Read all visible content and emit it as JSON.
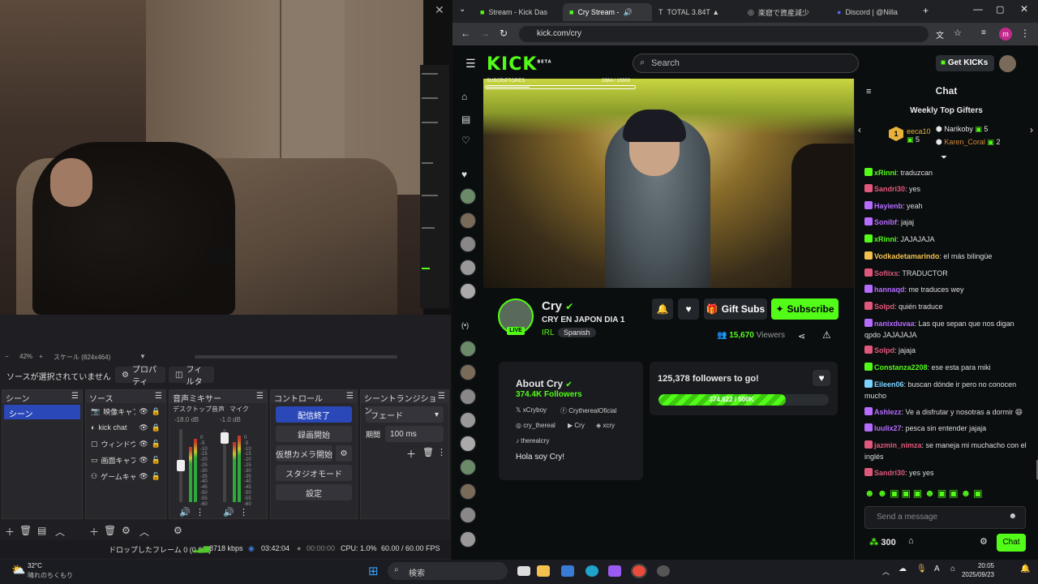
{
  "obs": {
    "zoom": "42%",
    "scale_label": "スケール (824x464)",
    "no_source": "ソースが選択されていません",
    "properties": "プロパティ",
    "filters": "フィルタ",
    "docks": {
      "scenes": "シーン",
      "sources": "ソース",
      "mixer": "音声ミキサー",
      "controls": "コントロール",
      "transitions": "シーントランジション"
    },
    "scene_item": "シーン",
    "sources": [
      "映像キャプ",
      "kick chat",
      "ウィンドウキ",
      "画面キャプ",
      "ゲームキャプ"
    ],
    "mixer": {
      "ch1": "デスクトップ音声",
      "ch1_db": "-18.0 dB",
      "ch2": "マイク",
      "ch2_db": "-1.0 dB",
      "scale": [
        "0",
        "-5",
        "-10",
        "-15",
        "-20",
        "-25",
        "-30",
        "-35",
        "-40",
        "-45",
        "-50",
        "-55",
        "-60"
      ]
    },
    "controls": [
      "配信終了",
      "録画開始",
      "仮想カメラ開始",
      "スタジオモード",
      "設定"
    ],
    "transition": "フェード",
    "duration_label": "期間",
    "duration": "100 ms",
    "status": {
      "dropped": "ドロップしたフレーム 0 (0.0%)",
      "kbps": "8718 kbps",
      "stream_time": "03:42:04",
      "rec_time": "00:00:00",
      "cpu": "CPU: 1.0%",
      "fps": "60.00 / 60.00 FPS"
    }
  },
  "browser": {
    "tabs": [
      "Stream - Kick Das",
      "Cry Stream - ",
      "TOTAL 3.84T ▲",
      "楽窟で資産減少",
      "Discord | @Nilla"
    ],
    "url": "kick.com/cry",
    "profile": "m"
  },
  "kick": {
    "logo": "KICK",
    "beta": "BETA",
    "search": "Search",
    "get_kicks": "Get KICKs",
    "sub_label": "SUSCRIPTORES",
    "sub_count": "2884 / 10000",
    "sub_fraction": 0.2884,
    "channel": "Cry",
    "title": "CRY EN JAPON DIA 1",
    "category": "IRL",
    "language": "Spanish",
    "live": "LIVE",
    "gift": "Gift Subs",
    "subscribe": "Subscribe",
    "viewers": "15,670",
    "viewers_label": "Viewers",
    "about_title": "About Cry",
    "followers": "374.4K",
    "followers_label": "Followers",
    "socials": [
      "xCryboy",
      "CrytherealOficial",
      "cry_thereal",
      "Cry",
      "xcry",
      "therealcry"
    ],
    "bio": "Hola soy Cry!",
    "goal_title": "125,378 followers to go!",
    "goal_progress": "374,622 / 500K",
    "goal_fraction": 0.749
  },
  "chat": {
    "title": "Chat",
    "gifters_title": "Weekly Top Gifters",
    "gifters": [
      {
        "name": "eeca10",
        "count": "5",
        "color": "#e8b13a"
      },
      {
        "name": "Narikoby",
        "count": "5",
        "color": "#cfcfcf"
      },
      {
        "name": "Karen_Coral",
        "count": "2",
        "color": "#d58a3a"
      }
    ],
    "messages": [
      {
        "user": "xRinni",
        "text": "traduzcan",
        "color": "#53fc18"
      },
      {
        "user": "Sandri30",
        "text": "yes",
        "color": "#e0587b"
      },
      {
        "user": "Hayienb",
        "text": "yeah",
        "color": "#b56cff"
      },
      {
        "user": "Sonibf",
        "text": "jajaj",
        "color": "#b56cff"
      },
      {
        "user": "xRinni",
        "text": "JAJAJAJA",
        "color": "#53fc18"
      },
      {
        "user": "Vodkadetamarindo",
        "text": "el más bilingüe",
        "color": "#f2c14e"
      },
      {
        "user": "Sofiixs",
        "text": "TRADUCTOR",
        "color": "#e0587b"
      },
      {
        "user": "hannaqd",
        "text": "me traduces wey",
        "color": "#b56cff"
      },
      {
        "user": "Solpd",
        "text": "quién traduce",
        "color": "#e0587b"
      },
      {
        "user": "nanixduvaa",
        "text": "Las que sepan que nos digan qpdo JAJAJAJA",
        "color": "#b56cff"
      },
      {
        "user": "Solpd",
        "text": "jajaja",
        "color": "#e0587b"
      },
      {
        "user": "Constanza2208",
        "text": "ese esta para miki",
        "color": "#53fc18"
      },
      {
        "user": "Eileen06",
        "text": "buscan dónde ir pero no conocen mucho",
        "color": "#7ad3ff"
      },
      {
        "user": "Ashlezz",
        "text": "Ve a disfrutar y nosotras a dormir 😄",
        "color": "#b56cff"
      },
      {
        "user": "luulix27",
        "text": "pesca sin entender jajaja",
        "color": "#b56cff"
      },
      {
        "user": "jazmin_nimza",
        "text": "se maneja mi muchacho con el inglés",
        "color": "#e0587b"
      },
      {
        "user": "Sandri30",
        "text": "yes yes",
        "color": "#e0587b"
      }
    ],
    "send_placeholder": "Send a message",
    "points": "300",
    "chat_button": "Chat"
  },
  "taskbar": {
    "temp": "32°C",
    "weather": "晴れのちくもり",
    "search": "検索",
    "time": "20:05",
    "date": "2025/09/23"
  }
}
